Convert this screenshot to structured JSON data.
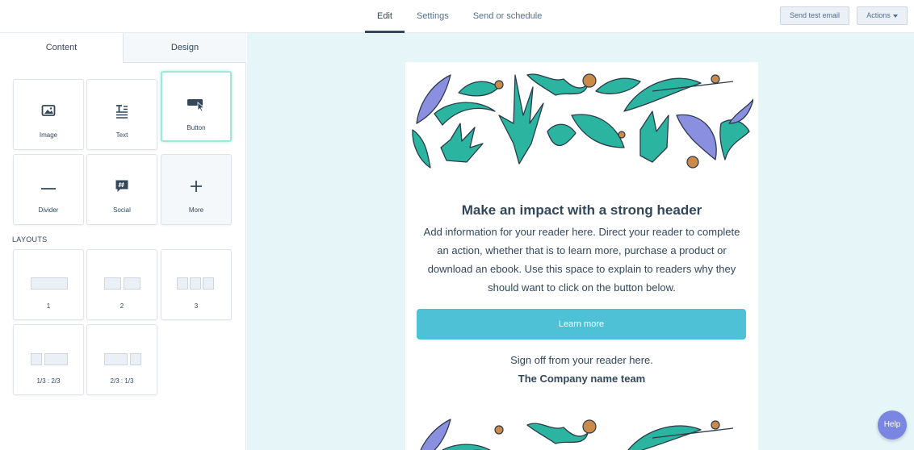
{
  "nav": {
    "tabs": [
      "Edit",
      "Settings",
      "Send or schedule"
    ],
    "active": "Edit"
  },
  "toolbar": {
    "send_test_label": "Send test email",
    "actions_label": "Actions"
  },
  "panel": {
    "tabs": {
      "content": "Content",
      "design": "Design"
    },
    "modules": [
      {
        "label": "Image",
        "icon": "image-icon"
      },
      {
        "label": "Text",
        "icon": "text-icon"
      },
      {
        "label": "Button",
        "icon": "button-icon"
      },
      {
        "label": "Divider",
        "icon": "divider-icon"
      },
      {
        "label": "Social",
        "icon": "social-icon"
      },
      {
        "label": "More",
        "icon": "plus-icon"
      }
    ],
    "layouts_heading": "LAYOUTS",
    "layouts": [
      "1",
      "2",
      "3",
      "1/3 : 2/3",
      "2/3 : 1/3"
    ]
  },
  "email": {
    "header": "Make an impact with a strong header",
    "body": "Add information for your reader here. Direct your reader to complete an action, whether that is to learn more, purchase a product or download an ebook. Use this space to explain to readers why they should want to click on the button below.",
    "cta": "Learn more",
    "signoff": "Sign off from your reader here.",
    "company": "The Company name team"
  },
  "help_label": "Help",
  "colors": {
    "accent": "#4fc1d6",
    "canvas": "#e5f5f8",
    "help": "#7b86e3",
    "leaf_teal": "#2bb5a0",
    "leaf_purple": "#8b8fe0",
    "dot": "#c98a4a"
  }
}
